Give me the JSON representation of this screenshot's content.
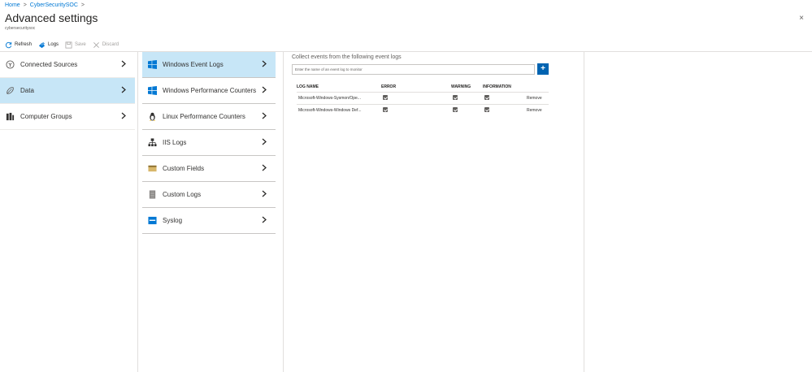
{
  "breadcrumb": {
    "home": "Home",
    "sep1": ">",
    "workspace": "CyberSecuritySOC",
    "sep2": ">"
  },
  "header": {
    "title": "Advanced settings",
    "subtitle": "cybersecuritysoc",
    "close": "×"
  },
  "toolbar": {
    "refresh": "Refresh",
    "logs": "Logs",
    "save": "Save",
    "discard": "Discard"
  },
  "col1": {
    "items": [
      {
        "label": "Connected Sources",
        "icon": "connected-sources-icon",
        "selected": false
      },
      {
        "label": "Data",
        "icon": "data-icon",
        "selected": true
      },
      {
        "label": "Computer Groups",
        "icon": "computer-groups-icon",
        "selected": false
      }
    ]
  },
  "col2": {
    "items": [
      {
        "label": "Windows Event Logs",
        "icon": "windows-icon",
        "selected": true
      },
      {
        "label": "Windows Performance Counters",
        "icon": "windows-icon",
        "selected": false
      },
      {
        "label": "Linux Performance Counters",
        "icon": "linux-icon",
        "selected": false
      },
      {
        "label": "IIS Logs",
        "icon": "iis-icon",
        "selected": false
      },
      {
        "label": "Custom Fields",
        "icon": "custom-fields-icon",
        "selected": false
      },
      {
        "label": "Custom Logs",
        "icon": "custom-logs-icon",
        "selected": false
      },
      {
        "label": "Syslog",
        "icon": "syslog-icon",
        "selected": false
      }
    ]
  },
  "event_logs": {
    "heading": "Collect events from the following event logs",
    "input_placeholder": "Enter the name of an event log to monitor",
    "add_label": "+",
    "columns": {
      "log_name": "LOG NAME",
      "error": "ERROR",
      "warning": "WARNING",
      "information": "INFORMATION"
    },
    "rows": [
      {
        "name": "Microsoft-Windows-Sysmon/Ope...",
        "error": true,
        "warning": true,
        "information": true,
        "action": "Remove"
      },
      {
        "name": "Microsoft-Windows-Windows Def...",
        "error": true,
        "warning": true,
        "information": true,
        "action": "Remove"
      }
    ]
  },
  "colors": {
    "accent": "#0078d4",
    "selected_bg": "#c7e6f7",
    "add_button": "#0063b1"
  }
}
